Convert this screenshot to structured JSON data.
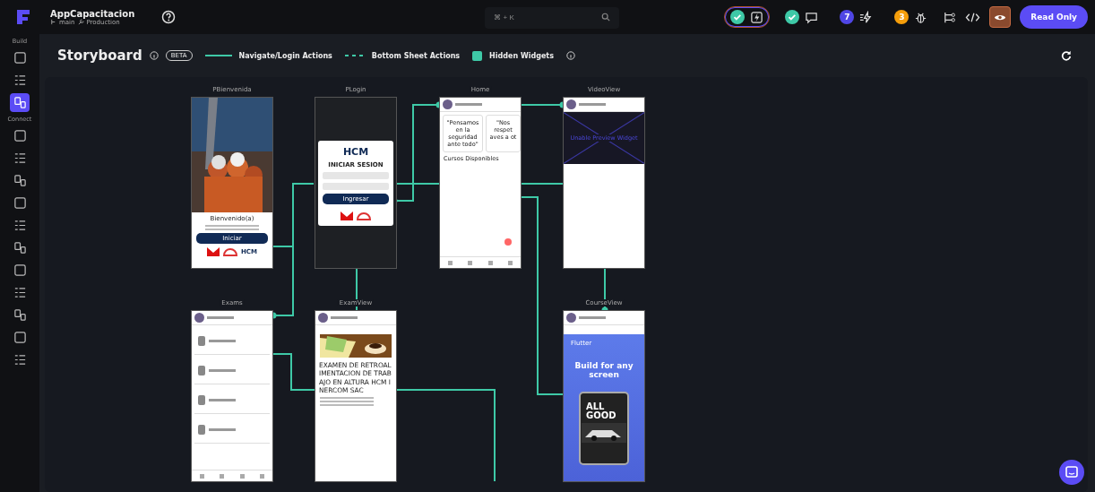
{
  "topbar": {
    "app_name": "AppCapacitacion",
    "branch": "main",
    "environment": "Production",
    "search": {
      "placeholder": "⌘ + K"
    },
    "indicators": [
      {
        "kind": "check",
        "selected": true
      },
      {
        "kind": "check",
        "selected": false
      },
      {
        "kind": "count",
        "count": "7",
        "color": "#4f46e5",
        "selected": false
      },
      {
        "kind": "count",
        "count": "3",
        "color": "#f59e0b",
        "selected": false
      }
    ],
    "preview_on": true,
    "mode_button": "Read Only"
  },
  "sidebar": {
    "sections": [
      {
        "label": "Build",
        "items": [
          {
            "selected": false
          },
          {
            "selected": false
          },
          {
            "selected": true
          }
        ]
      },
      {
        "label": "Connect",
        "items": [
          {
            "selected": false
          },
          {
            "selected": false
          },
          {
            "selected": false
          },
          {
            "selected": false
          },
          {
            "selected": false
          },
          {
            "selected": false
          },
          {
            "selected": false
          },
          {
            "selected": false
          },
          {
            "selected": false
          },
          {
            "selected": false
          },
          {
            "selected": false
          }
        ]
      }
    ]
  },
  "storyboard": {
    "title": "Storyboard",
    "badge": "BETA",
    "legend": [
      {
        "kind": "solid",
        "label": "Navigate/Login Actions"
      },
      {
        "kind": "dashed",
        "label": "Bottom Sheet Actions"
      },
      {
        "kind": "hidden",
        "label": "Hidden Widgets"
      }
    ],
    "screens": [
      {
        "kind": "welcome",
        "title": "PBienvenida",
        "heading": "Bienvenido(a)",
        "button": "Iniciar",
        "logo": "HCM"
      },
      {
        "kind": "login",
        "title": "PLogin",
        "logo": "HCM",
        "heading": "INICIAR SESION",
        "button": "Ingresar"
      },
      {
        "kind": "home",
        "title": "Home",
        "quotes": [
          "\"Pensamos en la seguridad ante todo\"",
          "\"Nos respet aves a ot"
        ],
        "section": "Cursos Disponibles"
      },
      {
        "kind": "video",
        "title": "VideoView",
        "message": "Unable Preview Widget"
      },
      {
        "kind": "exams",
        "title": "Exams"
      },
      {
        "kind": "exam",
        "title": "ExamView",
        "heading": "EXAMEN DE RETROALIMENTACION DE TRABAJO EN ALTURA HCM INERCOM SAC"
      },
      {
        "kind": "course",
        "title": "CourseView",
        "app": "Flutter",
        "heading": "Build for any screen",
        "promo": "ALL GOOD"
      }
    ]
  }
}
